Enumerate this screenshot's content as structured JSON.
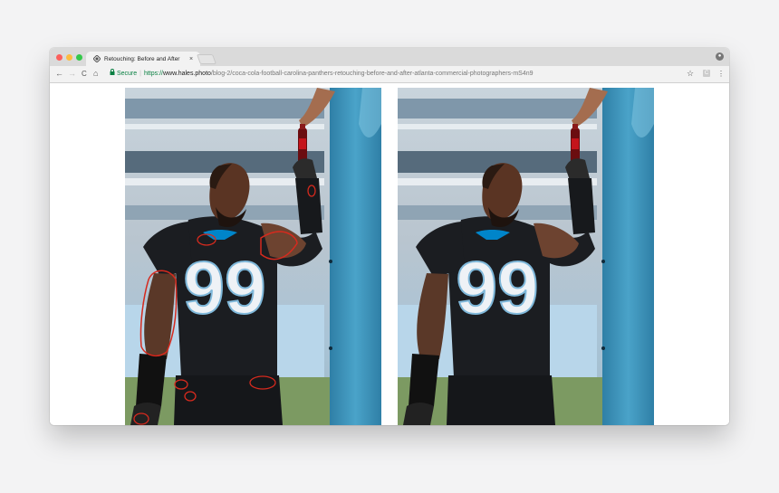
{
  "window": {
    "tab": {
      "title": "Retouching: Before and After",
      "favicon": "diamond-logo-icon",
      "close": "×"
    },
    "traffic_lights": {
      "close": "#fc605c",
      "minimize": "#fdbc40",
      "zoom": "#34c84a"
    }
  },
  "toolbar": {
    "back": "←",
    "forward": "→",
    "reload": "C",
    "home": "⌂",
    "security_label": "Secure",
    "url_scheme": "https://",
    "url_domain": "www.hales.photo",
    "url_path": "/blog-2/coca-cola-football-carolina-panthers-retouching-before-and-after-atlanta-commercial-photographers-mS4n9",
    "bookmark": "☆",
    "extension": "C",
    "menu": "⋮"
  },
  "colors": {
    "jersey": "#1b1d21",
    "panthers_blue": "#0085ca",
    "pad_blue": "#3c93b8",
    "annotation_red": "#d62a1e",
    "sky": "#c9d4dc"
  },
  "photos": {
    "before": {
      "jersey_number": "99",
      "annotated": true
    },
    "after": {
      "jersey_number": "99",
      "annotated": false
    }
  }
}
